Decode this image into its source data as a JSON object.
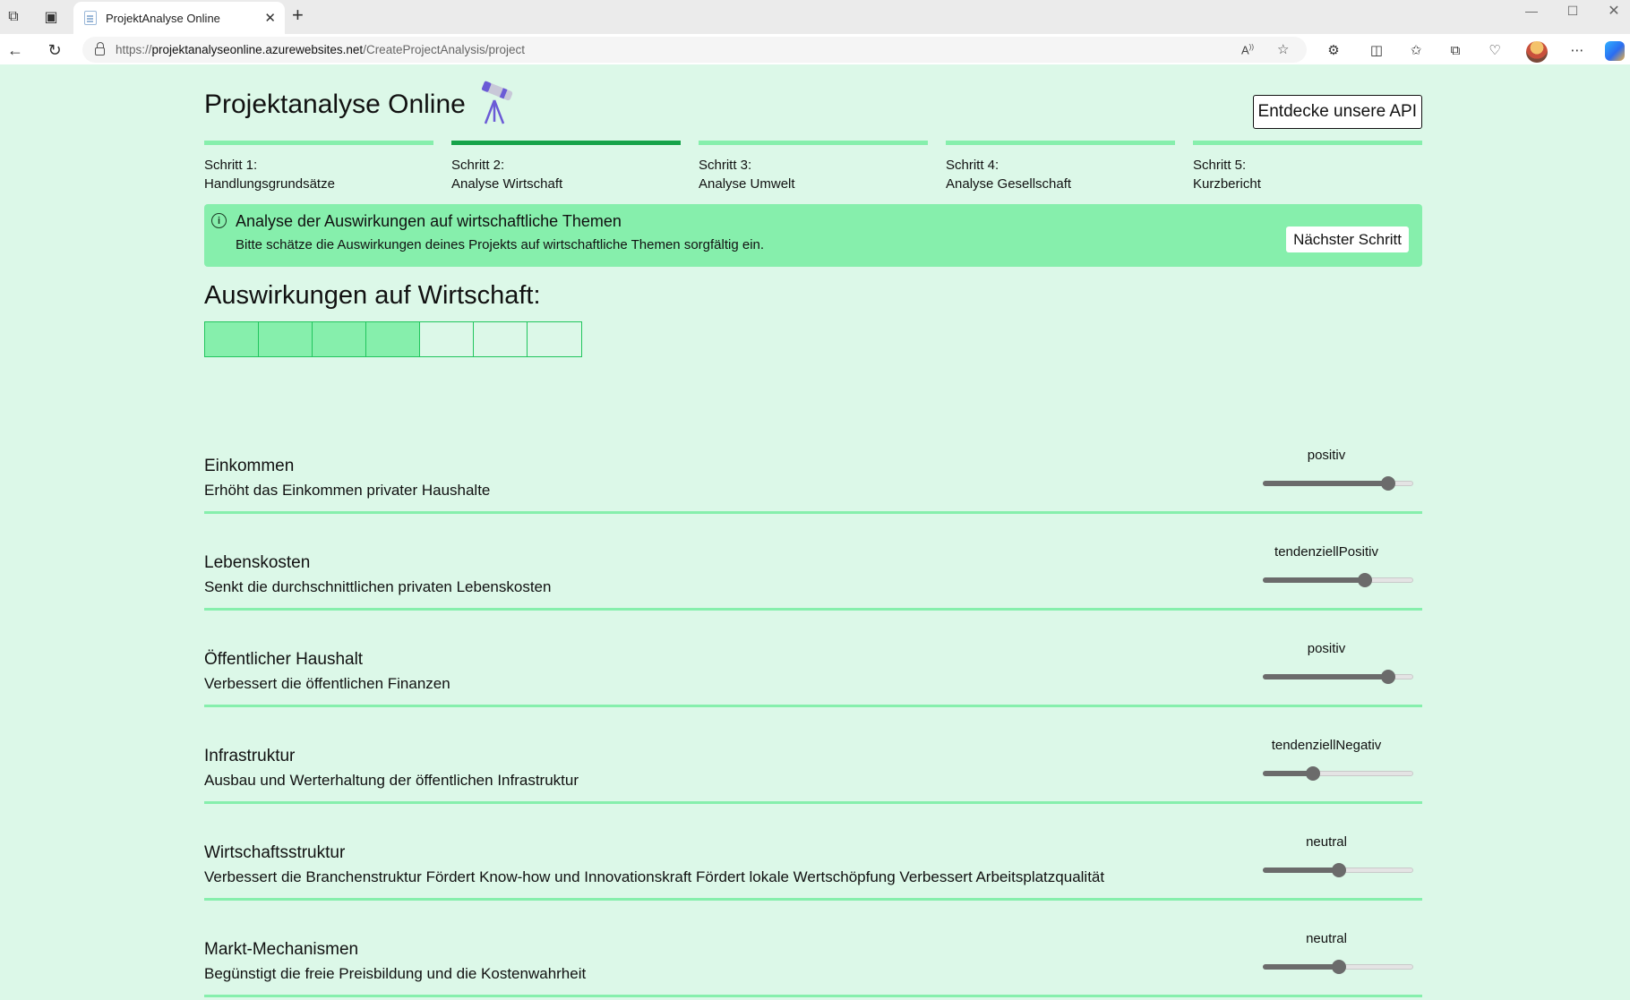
{
  "browser": {
    "tab_title": "ProjektAnalyse Online",
    "url_scheme": "https://",
    "url_host": "projektanalyseonline.azurewebsites.net",
    "url_path": "/CreateProjectAnalysis/project"
  },
  "header": {
    "brand": "Projektanalyse Online",
    "api_button": "Entdecke unsere API"
  },
  "steps": [
    {
      "num": "Schritt 1:",
      "name": "Handlungsgrundsätze",
      "active": false
    },
    {
      "num": "Schritt 2:",
      "name": "Analyse Wirtschaft",
      "active": true
    },
    {
      "num": "Schritt 3:",
      "name": "Analyse Umwelt",
      "active": false
    },
    {
      "num": "Schritt 4:",
      "name": "Analyse Gesellschaft",
      "active": false
    },
    {
      "num": "Schritt 5:",
      "name": "Kurzbericht",
      "active": false
    }
  ],
  "banner": {
    "title": "Analyse der Auswirkungen auf wirtschaftliche Themen",
    "text": "Bitte schätze die Auswirkungen deines Projekts auf wirtschaftliche Themen sorgfältig ein.",
    "next_button": "Nächster Schritt"
  },
  "section": {
    "title": "Auswirkungen auf Wirtschaft:",
    "score_filled": 4,
    "score_total": 7
  },
  "impacts": [
    {
      "name": "Einkommen",
      "desc": "Erhöht das Einkommen privater Haushalte",
      "value": "positiv",
      "level": 0.83
    },
    {
      "name": "Lebenskosten",
      "desc": "Senkt die durchschnittlichen privaten Lebenskosten",
      "value": "tendenziellPositiv",
      "level": 0.67
    },
    {
      "name": "Öffentlicher Haushalt",
      "desc": "Verbessert die öffentlichen Finanzen",
      "value": "positiv",
      "level": 0.83
    },
    {
      "name": "Infrastruktur",
      "desc": "Ausbau und Werterhaltung der öffentlichen Infrastruktur",
      "value": "tendenziellNegativ",
      "level": 0.33
    },
    {
      "name": "Wirtschaftsstruktur",
      "desc": "Verbessert die Branchenstruktur Fördert Know-how und Innovationskraft Fördert lokale Wertschöpfung Verbessert Arbeitsplatzqualität",
      "value": "neutral",
      "level": 0.5
    },
    {
      "name": "Markt-Mechanismen",
      "desc": "Begünstigt die freie Preisbildung und die Kostenwahrheit",
      "value": "neutral",
      "level": 0.5
    }
  ],
  "colors": {
    "page_bg": "#dcf8e8",
    "accent_light": "#86efac",
    "accent_dark": "#16a34a",
    "slider": "#6b6b6b"
  }
}
